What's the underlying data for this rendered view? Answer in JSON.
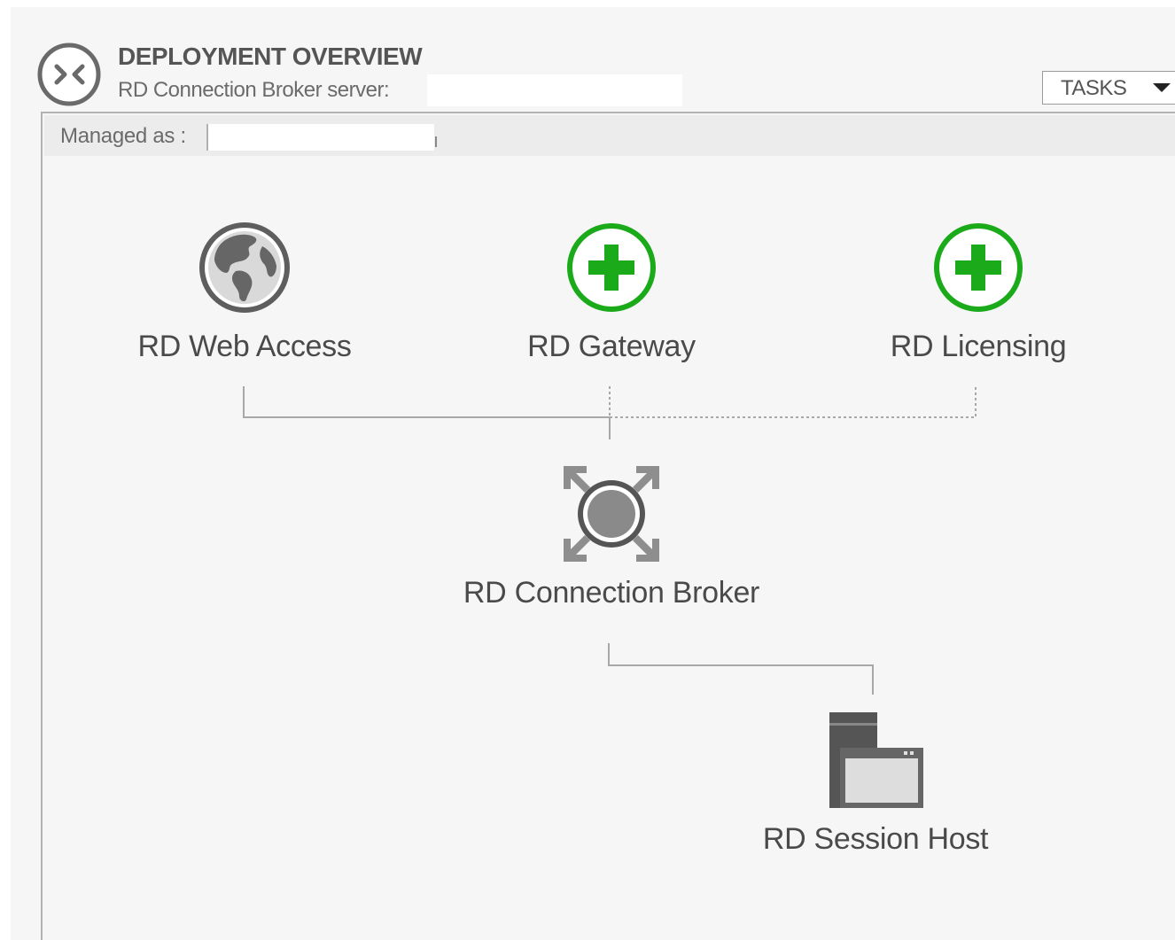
{
  "header": {
    "icon": "remote-desktop-icon",
    "title": "DEPLOYMENT OVERVIEW",
    "subtitle": "RD Connection Broker server:",
    "tasks_label": "TASKS"
  },
  "panel": {
    "managed_as_label": "Managed as :"
  },
  "nodes": {
    "web_access": {
      "label": "RD Web Access",
      "icon": "globe-icon"
    },
    "gateway": {
      "label": "RD Gateway",
      "icon": "add-role-icon"
    },
    "licensing": {
      "label": "RD Licensing",
      "icon": "add-role-icon"
    },
    "connection_broker": {
      "label": "RD Connection Broker",
      "icon": "connection-broker-icon"
    },
    "session_host": {
      "label": "RD Session Host",
      "icon": "session-host-icon"
    }
  },
  "colors": {
    "add_green": "#1aaa1a",
    "icon_gray": "#6a6a6a",
    "line_gray": "#a8a8a8"
  }
}
